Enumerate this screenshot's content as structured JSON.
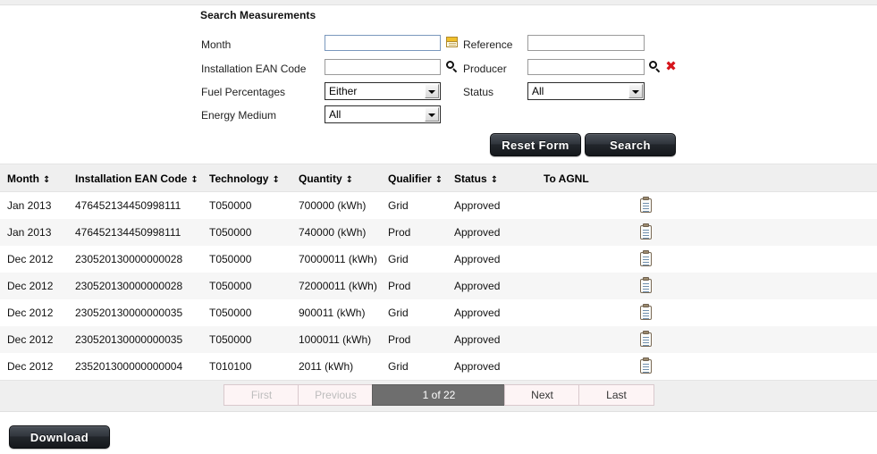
{
  "search": {
    "title": "Search Measurements",
    "fields": {
      "month": {
        "label": "Month",
        "value": "",
        "placeholder": ""
      },
      "installation": {
        "label": "Installation EAN Code",
        "value": "",
        "placeholder": ""
      },
      "fuel": {
        "label": "Fuel Percentages",
        "value": "Either"
      },
      "energy": {
        "label": "Energy Medium",
        "value": "All"
      },
      "reference": {
        "label": "Reference",
        "value": "",
        "placeholder": ""
      },
      "producer": {
        "label": "Producer",
        "value": "",
        "placeholder": ""
      },
      "status": {
        "label": "Status",
        "value": "All"
      }
    },
    "icons": {
      "calendar": "calendar-icon",
      "magnifier": "search-icon",
      "producer_search": "search-icon",
      "clear": "clear-icon"
    },
    "buttons": {
      "reset": "Reset Form",
      "search": "Search"
    }
  },
  "table": {
    "columns": [
      {
        "label": "Month",
        "sortable": true
      },
      {
        "label": "Installation EAN Code",
        "sortable": true
      },
      {
        "label": "Technology",
        "sortable": true
      },
      {
        "label": "Quantity",
        "sortable": true
      },
      {
        "label": "Qualifier",
        "sortable": true
      },
      {
        "label": "Status",
        "sortable": true
      },
      {
        "label": "To AGNL",
        "sortable": false
      }
    ],
    "sort_glyph": "↕",
    "rows": [
      {
        "month": "Jan 2013",
        "ean": "476452134450998111",
        "technology": "T050000",
        "quantity": "700000 (kWh)",
        "qualifier": "Grid",
        "status": "Approved",
        "agnl_icon": "clipboard-icon"
      },
      {
        "month": "Jan 2013",
        "ean": "476452134450998111",
        "technology": "T050000",
        "quantity": "740000 (kWh)",
        "qualifier": "Prod",
        "status": "Approved",
        "agnl_icon": "clipboard-icon"
      },
      {
        "month": "Dec 2012",
        "ean": "230520130000000028",
        "technology": "T050000",
        "quantity": "70000011 (kWh)",
        "qualifier": "Grid",
        "status": "Approved",
        "agnl_icon": "clipboard-icon"
      },
      {
        "month": "Dec 2012",
        "ean": "230520130000000028",
        "technology": "T050000",
        "quantity": "72000011 (kWh)",
        "qualifier": "Prod",
        "status": "Approved",
        "agnl_icon": "clipboard-icon"
      },
      {
        "month": "Dec 2012",
        "ean": "230520130000000035",
        "technology": "T050000",
        "quantity": "900011 (kWh)",
        "qualifier": "Grid",
        "status": "Approved",
        "agnl_icon": "clipboard-icon"
      },
      {
        "month": "Dec 2012",
        "ean": "230520130000000035",
        "technology": "T050000",
        "quantity": "1000011 (kWh)",
        "qualifier": "Prod",
        "status": "Approved",
        "agnl_icon": "clipboard-icon"
      },
      {
        "month": "Dec 2012",
        "ean": "235201300000000004",
        "technology": "T010100",
        "quantity": "2011 (kWh)",
        "qualifier": "Grid",
        "status": "Approved",
        "agnl_icon": "clipboard-icon"
      }
    ]
  },
  "pagination": {
    "first": "First",
    "previous": "Previous",
    "current": "1 of 22",
    "next": "Next",
    "last": "Last",
    "page": 1,
    "total_pages": 22
  },
  "footer": {
    "download": "Download"
  },
  "colors": {
    "page_background": "#ffffff",
    "header_row": "#efefef",
    "row_alt": "#f6f6f6",
    "button_dark": "#22262b",
    "current_page": "#6e6e6e",
    "pager_button": "#fdf4f5",
    "clear_icon": "#d6141b",
    "focus_border": "#7a98bd"
  }
}
